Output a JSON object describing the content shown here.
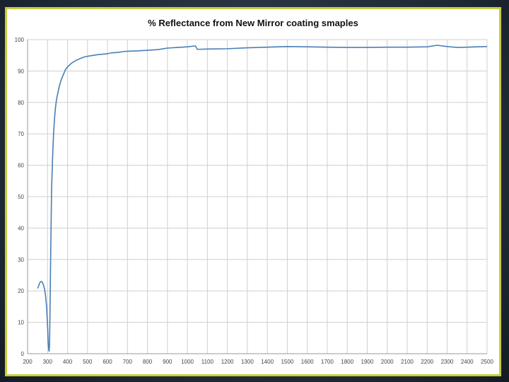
{
  "chart_data": {
    "type": "line",
    "title": "% Reflectance from New Mirror coating smaples",
    "xlabel": "",
    "ylabel": "",
    "xlim": [
      200,
      2500
    ],
    "ylim": [
      0,
      100
    ],
    "x_ticks": [
      200,
      300,
      400,
      500,
      600,
      700,
      800,
      900,
      1000,
      1100,
      1200,
      1300,
      1400,
      1500,
      1600,
      1700,
      1800,
      1900,
      2000,
      2100,
      2200,
      2300,
      2400,
      2500
    ],
    "y_ticks": [
      0,
      10,
      20,
      30,
      40,
      50,
      60,
      70,
      80,
      90,
      100
    ],
    "grid": true,
    "legend": "none",
    "series_color": "#4a7eb5",
    "series": [
      {
        "x": [
          250,
          255,
          260,
          265,
          270,
          275,
          280,
          285,
          290,
          295,
          300,
          303,
          306,
          308,
          310,
          312,
          315,
          318,
          320,
          325,
          330,
          335,
          340,
          345,
          350,
          355,
          360,
          370,
          380,
          390,
          400,
          420,
          440,
          460,
          480,
          500,
          550,
          600,
          620,
          650,
          680,
          700,
          750,
          800,
          850,
          900,
          950,
          1000,
          1040,
          1050,
          1100,
          1200,
          1300,
          1400,
          1500,
          1600,
          1700,
          1800,
          1900,
          2000,
          2100,
          2200,
          2250,
          2300,
          2350,
          2400,
          2450,
          2500
        ],
        "y": [
          20.8,
          21.5,
          22.4,
          22.9,
          23.0,
          22.6,
          21.8,
          20.6,
          18.5,
          15.0,
          9.0,
          4.0,
          1.2,
          0.8,
          3.0,
          12.0,
          28.0,
          42.0,
          52.0,
          62.0,
          70.0,
          75.0,
          78.5,
          81.0,
          82.5,
          84.0,
          85.5,
          87.5,
          89.0,
          90.5,
          91.3,
          92.5,
          93.3,
          93.9,
          94.4,
          94.7,
          95.2,
          95.5,
          95.8,
          95.9,
          96.2,
          96.3,
          96.4,
          96.6,
          96.8,
          97.3,
          97.5,
          97.7,
          98.0,
          96.9,
          97.0,
          97.1,
          97.4,
          97.6,
          97.8,
          97.7,
          97.6,
          97.5,
          97.5,
          97.6,
          97.6,
          97.7,
          98.2,
          97.8,
          97.5,
          97.6,
          97.7,
          97.8
        ]
      }
    ]
  }
}
